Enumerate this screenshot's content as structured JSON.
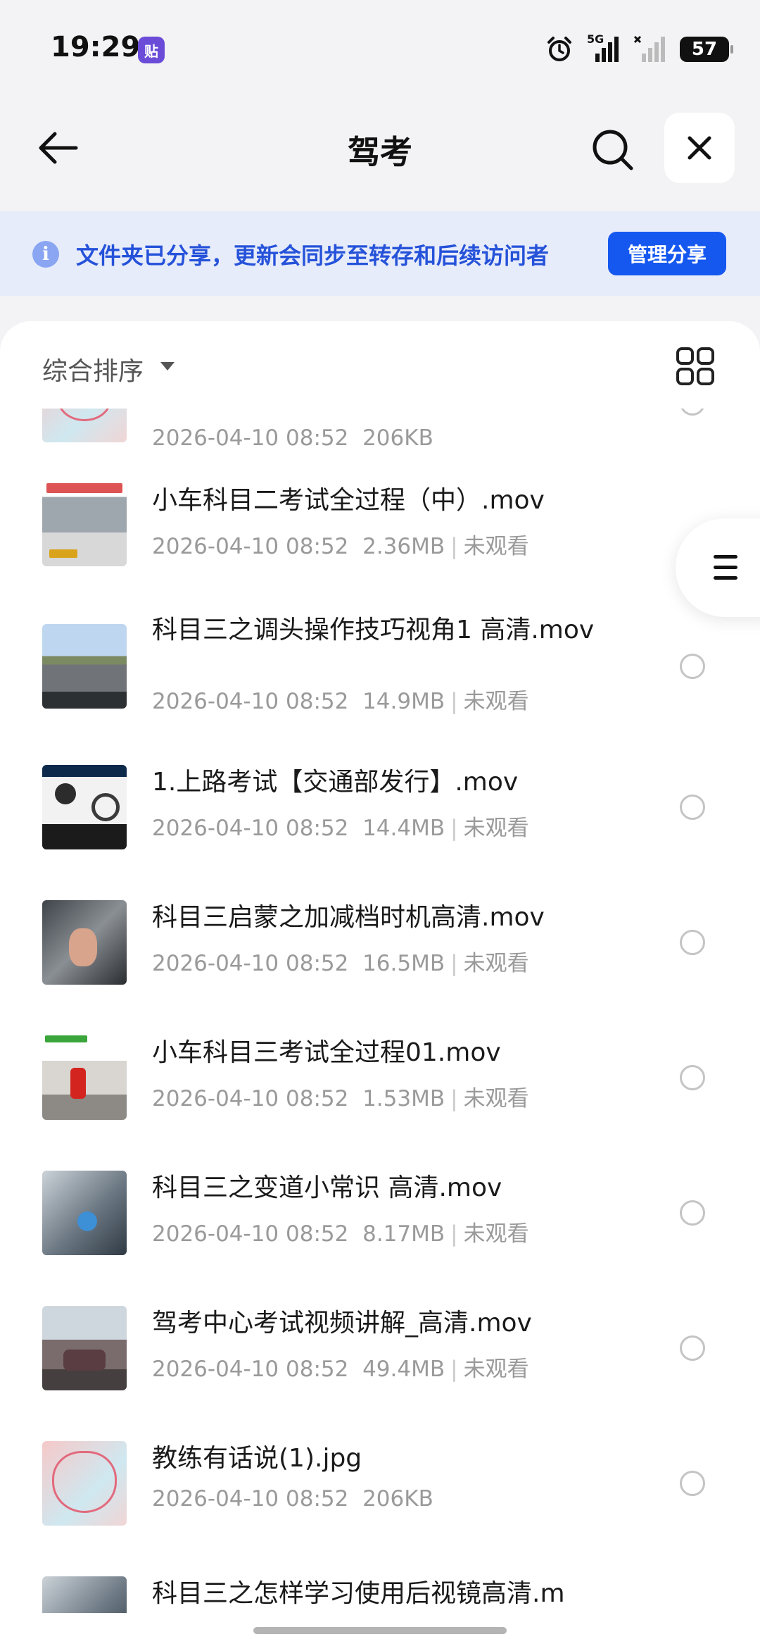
{
  "status_bar": {
    "time": "19:29",
    "app_badge": "贴",
    "network_label": "5G",
    "battery": "57"
  },
  "nav": {
    "title": "驾考"
  },
  "banner": {
    "text": "文件夹已分享，更新会同步至转存和后续访问者",
    "button": "管理分享"
  },
  "sort": {
    "label": "综合排序"
  },
  "files": [
    {
      "name": "",
      "date": "2026-04-10 08:52",
      "size": "206KB",
      "status": "",
      "thumb": "heart"
    },
    {
      "name": "小车科目二考试全过程（中）.mov",
      "date": "2026-04-10 08:52",
      "size": "2.36MB",
      "status": "未观看",
      "thumb": "car"
    },
    {
      "name": "科目三之调头操作技巧视角1 高清.mov",
      "date": "2026-04-10 08:52",
      "size": "14.9MB",
      "status": "未观看",
      "thumb": "road"
    },
    {
      "name": "1.上路考试【交通部发行】.mov",
      "date": "2026-04-10 08:52",
      "size": "14.4MB",
      "status": "未观看",
      "thumb": "driver"
    },
    {
      "name": "科目三启蒙之加减档时机高清.mov",
      "date": "2026-04-10 08:52",
      "size": "16.5MB",
      "status": "未观看",
      "thumb": "hand"
    },
    {
      "name": "小车科目三考试全过程01.mov",
      "date": "2026-04-10 08:52",
      "size": "1.53MB",
      "status": "未观看",
      "thumb": "person"
    },
    {
      "name": "科目三之变道小常识 高清.mov",
      "date": "2026-04-10 08:52",
      "size": "8.17MB",
      "status": "未观看",
      "thumb": "paper"
    },
    {
      "name": "驾考中心考试视频讲解_高清.mov",
      "date": "2026-04-10 08:52",
      "size": "49.4MB",
      "status": "未观看",
      "thumb": "street"
    },
    {
      "name": "教练有话说(1).jpg",
      "date": "2026-04-10 08:52",
      "size": "206KB",
      "status": "",
      "thumb": "heart"
    },
    {
      "name": "科目三之怎样学习使用后视镜高清.m",
      "date": "",
      "size": "",
      "status": "",
      "thumb": "paper"
    }
  ]
}
